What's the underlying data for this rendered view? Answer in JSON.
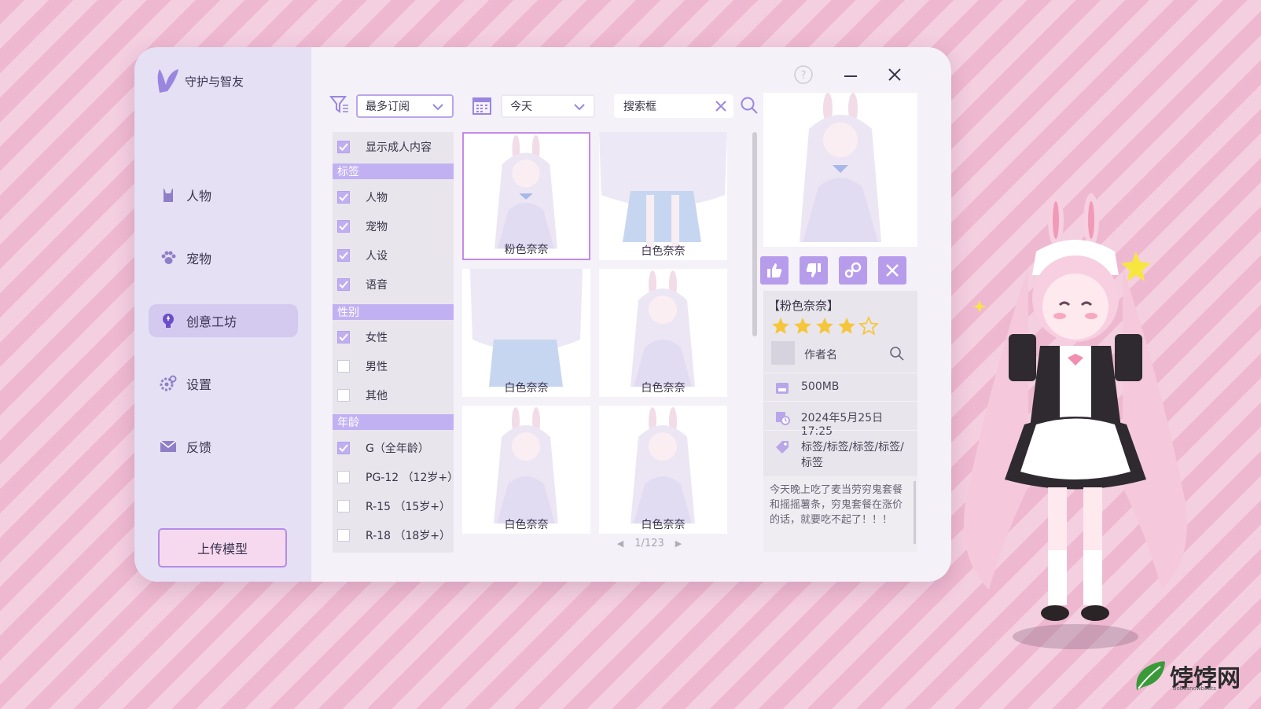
{
  "app": {
    "name": "守护与智友",
    "nav": [
      {
        "label": "人物",
        "icon": "rabbit-icon"
      },
      {
        "label": "宠物",
        "icon": "paw-icon"
      },
      {
        "label": "创意工坊",
        "icon": "lightbulb-icon",
        "active": true
      },
      {
        "label": "设置",
        "icon": "gear-icon"
      },
      {
        "label": "反馈",
        "icon": "envelope-icon"
      }
    ],
    "upload_label": "上传模型"
  },
  "toolbar": {
    "sort_value": "最多订阅",
    "date_value": "今天",
    "search_value": "搜索框"
  },
  "filters": {
    "adult": {
      "label": "显示成人内容",
      "checked": true
    },
    "tags_header": "标签",
    "tags": [
      {
        "label": "人物",
        "checked": true
      },
      {
        "label": "宠物",
        "checked": true
      },
      {
        "label": "人设",
        "checked": true
      },
      {
        "label": "语音",
        "checked": true
      }
    ],
    "gender_header": "性别",
    "gender": [
      {
        "label": "女性",
        "checked": true
      },
      {
        "label": "男性",
        "checked": false
      },
      {
        "label": "其他",
        "checked": false
      }
    ],
    "age_header": "年龄",
    "age": [
      {
        "label": "G（全年龄）",
        "checked": true
      },
      {
        "label": "PG-12 （12岁+）",
        "checked": false
      },
      {
        "label": "R-15 （15岁+）",
        "checked": false
      },
      {
        "label": "R-18 （18岁+）",
        "checked": false
      }
    ]
  },
  "grid": {
    "items": [
      {
        "label": "粉色奈奈",
        "selected": true
      },
      {
        "label": "白色奈奈"
      },
      {
        "label": "白色奈奈"
      },
      {
        "label": "白色奈奈"
      },
      {
        "label": "白色奈奈"
      },
      {
        "label": "白色奈奈"
      }
    ],
    "pagination": "1/123"
  },
  "detail": {
    "title": "【粉色奈奈】",
    "rating": 4,
    "rating_max": 5,
    "author": "作者名",
    "size": "500MB",
    "date": "2024年5月25日 17:25",
    "tags": "标签/标签/标签/标签/标签",
    "description": "今天晚上吃了麦当劳穷鬼套餐和摇摇薯条，穷鬼套餐在涨价的话，就要吃不起了！！！"
  },
  "watermark": {
    "text": "饽饽网",
    "sub": "bobosnowboots"
  },
  "colors": {
    "accent": "#b89cec",
    "sidebar": "#e5e0f3",
    "section": "#c2b1f2",
    "window": "#f4f1f8"
  }
}
